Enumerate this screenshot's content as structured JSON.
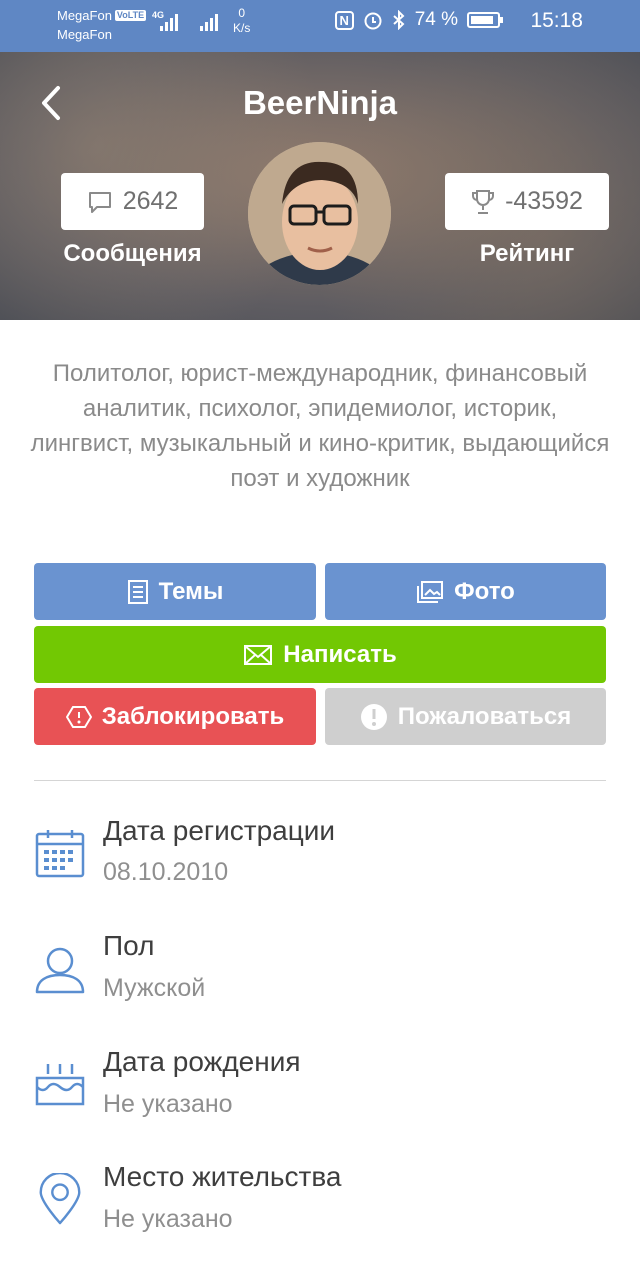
{
  "status_bar": {
    "carrier1": "MegaFon",
    "carrier2": "MegaFon",
    "volte": "VoLTE",
    "network": "4G",
    "speed_value": "0",
    "speed_unit": "K/s",
    "nfc": "N",
    "battery": "74 %",
    "time": "15:18"
  },
  "profile": {
    "username": "BeerNinja",
    "messages_count": "2642",
    "messages_label": "Сообщения",
    "rating_value": "-43592",
    "rating_label": "Рейтинг",
    "bio": "Политолог, юрист-международник, финансовый аналитик, психолог, эпидемиолог, историк, лингвист, музыкальный и кино-критик, выдающийся поэт и художник"
  },
  "actions": {
    "topics": "Темы",
    "photo": "Фото",
    "write": "Написать",
    "block": "Заблокировать",
    "report": "Пожаловаться"
  },
  "info": [
    {
      "title": "Дата регистрации",
      "value": "08.10.2010",
      "icon": "calendar-icon"
    },
    {
      "title": "Пол",
      "value": "Мужской",
      "icon": "person-icon"
    },
    {
      "title": "Дата рождения",
      "value": "Не указано",
      "icon": "cake-icon"
    },
    {
      "title": "Место жительства",
      "value": "Не указано",
      "icon": "location-pin-icon"
    }
  ],
  "colors": {
    "status_bar": "#5f87c4",
    "blue_button": "#6a93d0",
    "green_button": "#72c803",
    "red_button": "#e85255",
    "gray_button": "#cfcfcf",
    "icon_blue": "#5a8ed0"
  }
}
